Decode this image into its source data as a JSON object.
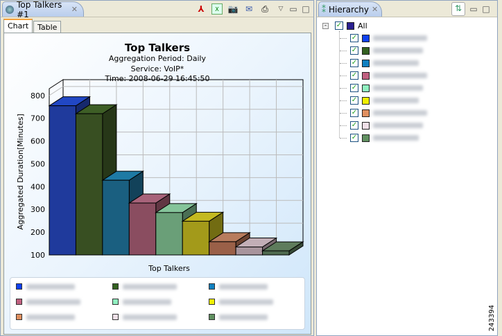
{
  "left_view": {
    "tab_title": "Top Talkers #1",
    "toolbar": [
      "pdf-export",
      "excel-export",
      "snapshot",
      "email",
      "print",
      "view-menu",
      "minimize",
      "maximize"
    ],
    "subtabs": [
      "Chart",
      "Table"
    ],
    "active_subtab": "Chart"
  },
  "chart_data": {
    "type": "bar",
    "style": "3d",
    "title": "Top Talkers",
    "subtitles": [
      "Aggregation Period: Daily",
      "Service: VoIP*",
      "Time: 2008-06-29 16:45:50"
    ],
    "xlabel": "Top Talkers",
    "ylabel": "Aggregated Duration[Minutes]",
    "ylim": [
      100,
      830
    ],
    "yticks": [
      "100",
      "200",
      "300",
      "400",
      "500",
      "600",
      "700",
      "800"
    ],
    "grid": true,
    "values": [
      755,
      720,
      428,
      328,
      286,
      248,
      158,
      135,
      118
    ],
    "colors": [
      "#1f3a9c",
      "#384f22",
      "#1a5f80",
      "#8a4d60",
      "#6a9f78",
      "#a39a1a",
      "#9a6048",
      "#a8949c",
      "#4f6a4f"
    ],
    "top_colors": [
      "#2147c4",
      "#3e5e26",
      "#1e7aa5",
      "#a8637a",
      "#85c49a",
      "#c4ba20",
      "#b87c5e",
      "#c2aeb6",
      "#5e7c5c"
    ],
    "legend_swatches": [
      "#1040f0",
      "#336020",
      "#1080c0",
      "#c06080",
      "#90f0c0",
      "#f0f000",
      "#e09060",
      "#f0e0e8",
      "#609060"
    ],
    "legend_placement": "bottom"
  },
  "right_view": {
    "tab_title": "Hierarchy",
    "root_label": "All",
    "root_color": "#2a2090"
  },
  "watermark": "243394"
}
